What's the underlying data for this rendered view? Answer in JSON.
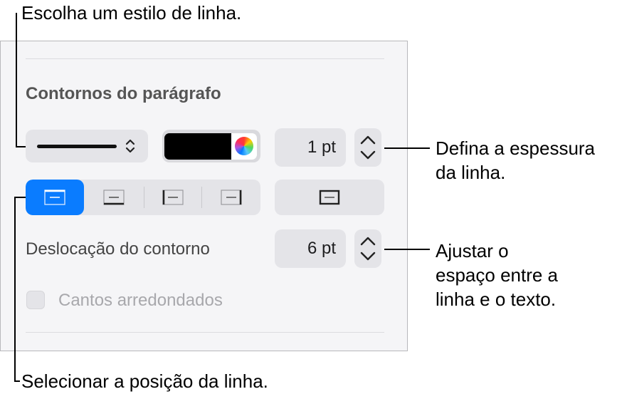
{
  "callouts": {
    "line_style": "Escolha um estilo de linha.",
    "thickness_line1": "Defina a espessura",
    "thickness_line2": "da linha.",
    "offset_line1": "Ajustar o",
    "offset_line2": "espaço entre a",
    "offset_line3": "linha e o texto.",
    "position": "Selecionar a posição da linha."
  },
  "panel": {
    "section_title": "Contornos do parágrafo",
    "width_value": "1 pt",
    "border_color": "#000000",
    "accent_color": "#0a7cff",
    "position_buttons": [
      {
        "name": "top-border-icon",
        "selected": true
      },
      {
        "name": "bottom-border-icon",
        "selected": false
      },
      {
        "name": "left-border-icon",
        "selected": false
      },
      {
        "name": "right-border-icon",
        "selected": false
      }
    ],
    "offset_label": "Deslocação do contorno",
    "offset_value": "6 pt",
    "rounded_corners_label": "Cantos arredondados",
    "rounded_corners_checked": false
  }
}
